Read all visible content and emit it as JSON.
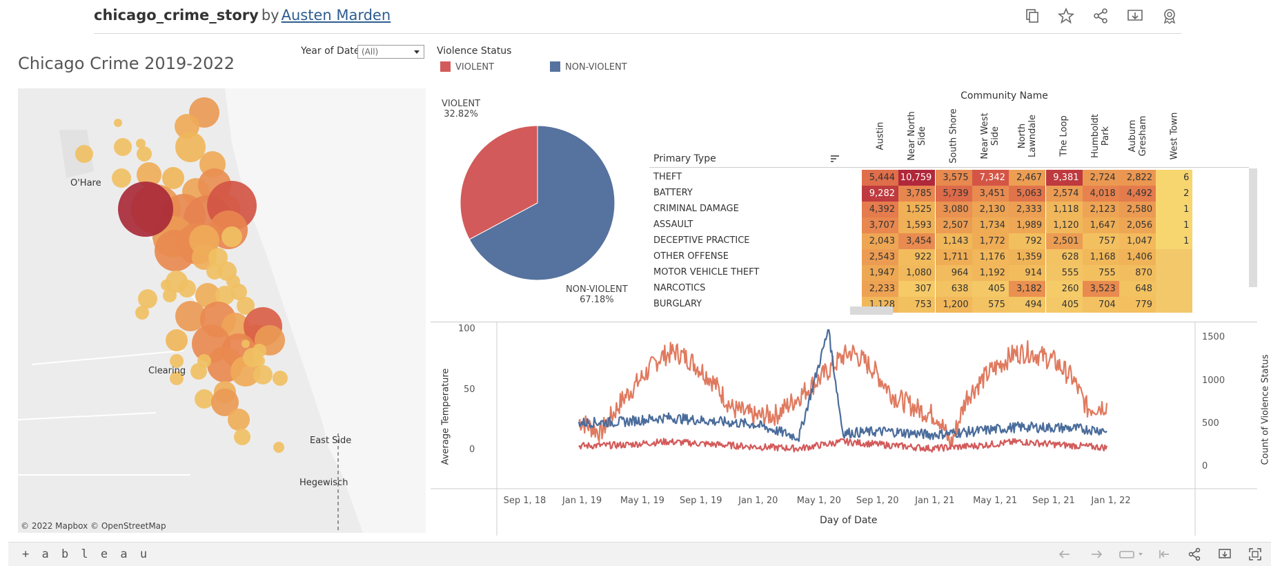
{
  "header": {
    "workbook_name": "chicago_crime_story",
    "by_label": "by",
    "author": "Austen Marden",
    "icons": [
      "duplicate-icon",
      "star-icon",
      "share-icon",
      "download-icon",
      "badge-icon"
    ]
  },
  "dashboard": {
    "title": "Chicago Crime 2019-2022",
    "year_filter": {
      "label": "Year of Date",
      "value": "(All)"
    },
    "legend": {
      "title": "Violence Status",
      "items": [
        {
          "label": "VIOLENT",
          "color": "#d35a5a"
        },
        {
          "label": "NON-VIOLENT",
          "color": "#56729e"
        }
      ]
    }
  },
  "map": {
    "labels": {
      "ohare": "O'Hare",
      "clearing": "Clearing",
      "east_side": "East Side",
      "hegewisch": "Hegewisch"
    },
    "credit": "© 2022 Mapbox  © OpenStreetMap"
  },
  "chart_data": [
    {
      "type": "pie",
      "slices": [
        {
          "label": "VIOLENT",
          "value": 32.82,
          "display": "32.82%",
          "color": "#d35a5a"
        },
        {
          "label": "NON-VIOLENT",
          "value": 67.18,
          "display": "67.18%",
          "color": "#56729e"
        }
      ]
    },
    {
      "type": "heatmap",
      "column_group_title": "Community Name",
      "row_header": "Primary Type",
      "columns": [
        "Austin",
        "Near North Side",
        "South Shore",
        "Near West Side",
        "North Lawndale",
        "The Loop",
        "Humboldt Park",
        "Auburn Gresham",
        "West Town"
      ],
      "rows": [
        {
          "label": "THEFT",
          "values": [
            "5,444",
            "10,759",
            "3,575",
            "7,342",
            "2,467",
            "9,381",
            "2,724",
            "2,822",
            "6"
          ]
        },
        {
          "label": "BATTERY",
          "values": [
            "9,282",
            "3,785",
            "5,739",
            "3,451",
            "5,063",
            "2,574",
            "4,018",
            "4,492",
            "2"
          ]
        },
        {
          "label": "CRIMINAL DAMAGE",
          "values": [
            "4,392",
            "1,525",
            "3,080",
            "2,130",
            "2,333",
            "1,118",
            "2,123",
            "2,580",
            "1"
          ]
        },
        {
          "label": "ASSAULT",
          "values": [
            "3,707",
            "1,593",
            "2,507",
            "1,734",
            "1,989",
            "1,120",
            "1,647",
            "2,056",
            "1"
          ]
        },
        {
          "label": "DECEPTIVE PRACTICE",
          "values": [
            "2,043",
            "3,454",
            "1,143",
            "1,772",
            "792",
            "2,501",
            "757",
            "1,047",
            "1"
          ]
        },
        {
          "label": "OTHER OFFENSE",
          "values": [
            "2,543",
            "922",
            "1,711",
            "1,176",
            "1,359",
            "628",
            "1,168",
            "1,406",
            ""
          ]
        },
        {
          "label": "MOTOR VEHICLE THEFT",
          "values": [
            "1,947",
            "1,080",
            "964",
            "1,192",
            "914",
            "555",
            "755",
            "870",
            ""
          ]
        },
        {
          "label": "NARCOTICS",
          "values": [
            "2,233",
            "307",
            "638",
            "405",
            "3,182",
            "260",
            "3,523",
            "648",
            ""
          ]
        },
        {
          "label": "BURGLARY",
          "values": [
            "1,128",
            "753",
            "1,200",
            "575",
            "494",
            "405",
            "704",
            "779",
            ""
          ]
        }
      ]
    },
    {
      "type": "line",
      "x_label": "Day of Date",
      "y_label": "Average Temperature",
      "y2_label": "Count of Violence Status",
      "x_ticks": [
        "Sep 1, 18",
        "Jan 1, 19",
        "May 1, 19",
        "Sep 1, 19",
        "Jan 1, 20",
        "May 1, 20",
        "Sep 1, 20",
        "Jan 1, 21",
        "May 1, 21",
        "Sep 1, 21",
        "Jan 1, 22"
      ],
      "y_ticks": [
        "100",
        "50",
        "0"
      ],
      "y2_ticks": [
        "1500",
        "1000",
        "500",
        "0"
      ],
      "y_range": [
        -28,
        100
      ],
      "y2_range": [
        -200,
        1600
      ],
      "series": [
        {
          "name": "Average Temperature",
          "color": "#e07a5f",
          "axis": "left",
          "points": [
            [
              "2019-01-01",
              25
            ],
            [
              "2019-02-15",
              15
            ],
            [
              "2019-04-01",
              42
            ],
            [
              "2019-05-15",
              62
            ],
            [
              "2019-06-20",
              78
            ],
            [
              "2019-07-20",
              82
            ],
            [
              "2019-08-20",
              75
            ],
            [
              "2019-10-01",
              60
            ],
            [
              "2019-11-15",
              35
            ],
            [
              "2020-01-01",
              28
            ],
            [
              "2020-02-15",
              30
            ],
            [
              "2020-04-01",
              45
            ],
            [
              "2020-05-15",
              60
            ],
            [
              "2020-07-01",
              78
            ],
            [
              "2020-07-20",
              82
            ],
            [
              "2020-09-01",
              68
            ],
            [
              "2020-10-15",
              45
            ],
            [
              "2020-12-01",
              35
            ],
            [
              "2021-01-15",
              28
            ],
            [
              "2021-02-10",
              5
            ],
            [
              "2021-03-15",
              45
            ],
            [
              "2021-05-01",
              65
            ],
            [
              "2021-06-20",
              80
            ],
            [
              "2021-07-20",
              82
            ],
            [
              "2021-09-10",
              75
            ],
            [
              "2021-10-20",
              60
            ],
            [
              "2021-11-20",
              35
            ],
            [
              "2021-12-31",
              38
            ]
          ]
        },
        {
          "name": "VIOLENT",
          "color": "#d35a5a",
          "axis": "right",
          "points": [
            [
              "2019-01-01",
              250
            ],
            [
              "2019-04-01",
              260
            ],
            [
              "2019-07-01",
              300
            ],
            [
              "2019-10-01",
              270
            ],
            [
              "2020-01-01",
              240
            ],
            [
              "2020-04-01",
              220
            ],
            [
              "2020-07-01",
              300
            ],
            [
              "2020-10-01",
              260
            ],
            [
              "2021-01-01",
              220
            ],
            [
              "2021-04-01",
              250
            ],
            [
              "2021-07-01",
              300
            ],
            [
              "2021-10-01",
              260
            ],
            [
              "2021-12-31",
              230
            ]
          ]
        },
        {
          "name": "NON-VIOLENT",
          "color": "#4a6c9b",
          "axis": "right",
          "points": [
            [
              "2019-01-01",
              520
            ],
            [
              "2019-04-01",
              530
            ],
            [
              "2019-07-01",
              580
            ],
            [
              "2019-10-01",
              540
            ],
            [
              "2020-01-01",
              500
            ],
            [
              "2020-04-01",
              350
            ],
            [
              "2020-06-01",
              1600
            ],
            [
              "2020-07-01",
              400
            ],
            [
              "2020-10-01",
              420
            ],
            [
              "2021-01-01",
              380
            ],
            [
              "2021-04-01",
              420
            ],
            [
              "2021-07-01",
              470
            ],
            [
              "2021-10-01",
              460
            ],
            [
              "2021-12-31",
              430
            ]
          ]
        }
      ]
    }
  ],
  "footer": {
    "logo": "+ a b l e a u"
  }
}
